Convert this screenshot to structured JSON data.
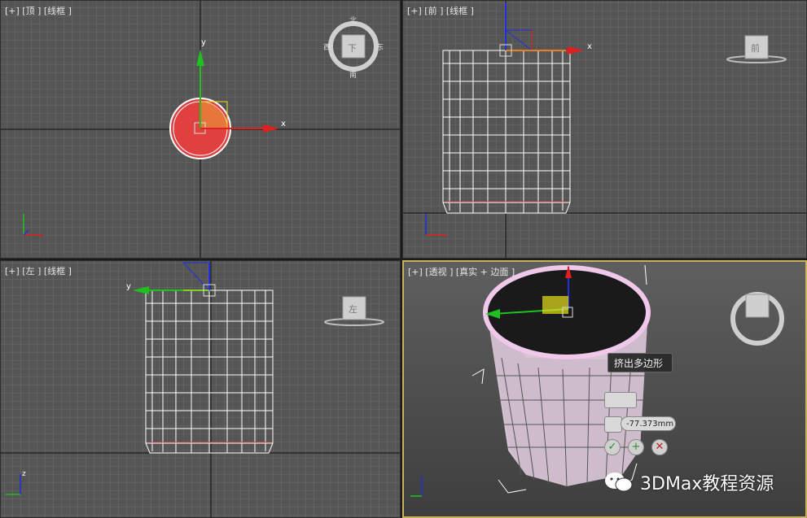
{
  "viewports": {
    "top": {
      "label": "[+] [顶 ] [线框 ]"
    },
    "front": {
      "label": "[+] [前 ] [线框 ]"
    },
    "left": {
      "label": "[+] [左 ] [线框 ]"
    },
    "perspective": {
      "label": "[+] [透视 ] [真实 + 边面 ]"
    }
  },
  "viewcube": {
    "top": {
      "face": "下",
      "north": "北",
      "south": "南",
      "east": "东",
      "west": "西"
    },
    "front": {
      "face": "前"
    },
    "left": {
      "face": "左"
    }
  },
  "gizmo": {
    "x_label": "x",
    "y_label": "y",
    "z_label": "z"
  },
  "caddy": {
    "title": "挤出多边形",
    "height_value": "-77.373mm",
    "ok_icon": "checkmark-icon",
    "apply_icon": "plus-icon",
    "cancel_icon": "x-icon"
  },
  "colors": {
    "viewport_bg": "#555555",
    "active_border": "#c9b25a",
    "axis_x": "#e02020",
    "axis_y": "#20c020",
    "axis_z": "#2030e0",
    "selection_fill": "#e04040"
  },
  "watermark": {
    "text": "3DMax教程资源"
  }
}
